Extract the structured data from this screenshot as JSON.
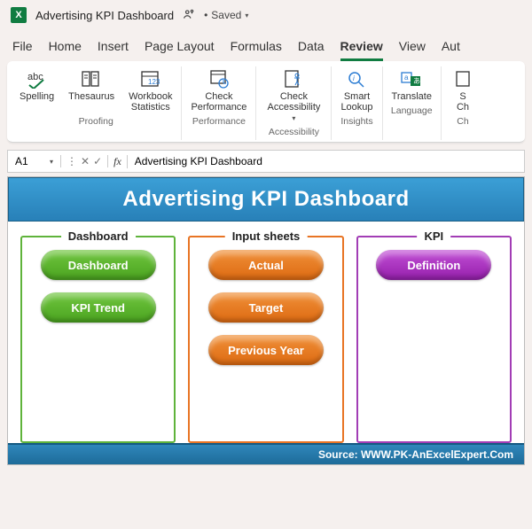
{
  "titlebar": {
    "doc_title": "Advertising KPI Dashboard",
    "saved_status": "Saved"
  },
  "ribbon": {
    "tabs": [
      "File",
      "Home",
      "Insert",
      "Page Layout",
      "Formulas",
      "Data",
      "Review",
      "View",
      "Aut"
    ],
    "active_tab": "Review",
    "proofing": {
      "spelling": "Spelling",
      "thesaurus": "Thesaurus",
      "workbook_stats": "Workbook\nStatistics",
      "group": "Proofing"
    },
    "performance": {
      "check_perf": "Check\nPerformance",
      "group": "Performance"
    },
    "accessibility": {
      "check_access": "Check\nAccessibility",
      "group": "Accessibility"
    },
    "insights": {
      "smart_lookup": "Smart\nLookup",
      "group": "Insights"
    },
    "language": {
      "translate": "Translate",
      "group": "Language"
    },
    "changes": {
      "show_changes": "S\nCh",
      "group": "Ch"
    }
  },
  "formula_bar": {
    "name_box": "A1",
    "content": "Advertising KPI Dashboard"
  },
  "dashboard": {
    "header": "Advertising KPI Dashboard",
    "panels": {
      "dashboard": {
        "title": "Dashboard",
        "buttons": [
          "Dashboard",
          "KPI Trend"
        ]
      },
      "input": {
        "title": "Input sheets",
        "buttons": [
          "Actual",
          "Target",
          "Previous Year"
        ]
      },
      "kpi": {
        "title": "KPI",
        "buttons": [
          "Definition"
        ]
      }
    },
    "footer": "Source: WWW.PK-AnExcelExpert.Com"
  }
}
